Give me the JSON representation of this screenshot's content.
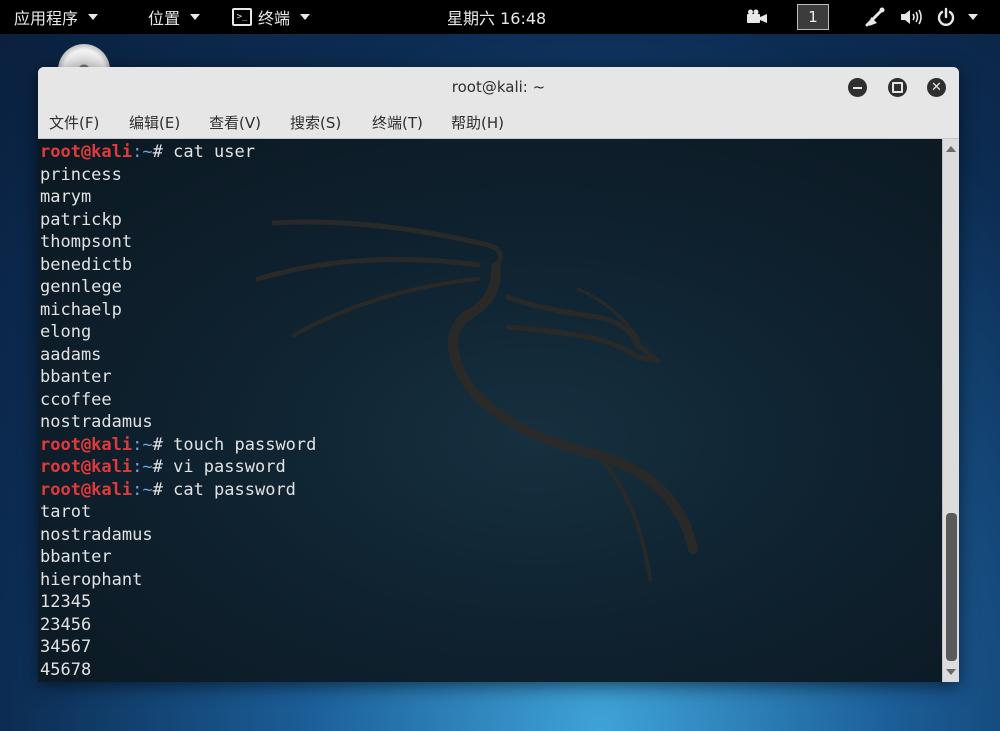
{
  "topbar": {
    "applications": "应用程序",
    "places": "位置",
    "terminal_app": "终端",
    "clock": "星期六 16:48",
    "workspace": "1"
  },
  "icons": {
    "video": "video-camera-icon",
    "workspace": "workspace-indicator",
    "network": "network-icon",
    "volume": "volume-icon",
    "power": "power-icon"
  },
  "window": {
    "title": "root@kali: ~",
    "menu": [
      "文件(F)",
      "编辑(E)",
      "查看(V)",
      "搜索(S)",
      "终端(T)",
      "帮助(H)"
    ]
  },
  "terminal": {
    "prompt_user": "root@kali",
    "prompt_path": ":~",
    "prompt_symbol": "# ",
    "lines": [
      {
        "type": "prompt",
        "cmd": "cat user"
      },
      {
        "type": "out",
        "text": "princess"
      },
      {
        "type": "out",
        "text": "marym"
      },
      {
        "type": "out",
        "text": "patrickp"
      },
      {
        "type": "out",
        "text": "thompsont"
      },
      {
        "type": "out",
        "text": "benedictb"
      },
      {
        "type": "out",
        "text": "gennlege"
      },
      {
        "type": "out",
        "text": "michaelp"
      },
      {
        "type": "out",
        "text": "elong"
      },
      {
        "type": "out",
        "text": "aadams"
      },
      {
        "type": "out",
        "text": "bbanter"
      },
      {
        "type": "out",
        "text": "ccoffee"
      },
      {
        "type": "out",
        "text": "nostradamus"
      },
      {
        "type": "prompt",
        "cmd": "touch password"
      },
      {
        "type": "prompt",
        "cmd": "vi password"
      },
      {
        "type": "prompt",
        "cmd": "cat password"
      },
      {
        "type": "out",
        "text": "tarot"
      },
      {
        "type": "out",
        "text": "nostradamus"
      },
      {
        "type": "out",
        "text": "bbanter"
      },
      {
        "type": "out",
        "text": "hierophant"
      },
      {
        "type": "out",
        "text": "12345"
      },
      {
        "type": "out",
        "text": "23456"
      },
      {
        "type": "out",
        "text": "34567"
      },
      {
        "type": "out",
        "text": "45678"
      }
    ]
  },
  "colors": {
    "prompt_user": "#e23a3a",
    "prompt_path": "#6d9fd9",
    "terminal_text": "#e2e2e2",
    "topbar_bg": "#000000",
    "window_chrome": "#e6e6e6"
  }
}
